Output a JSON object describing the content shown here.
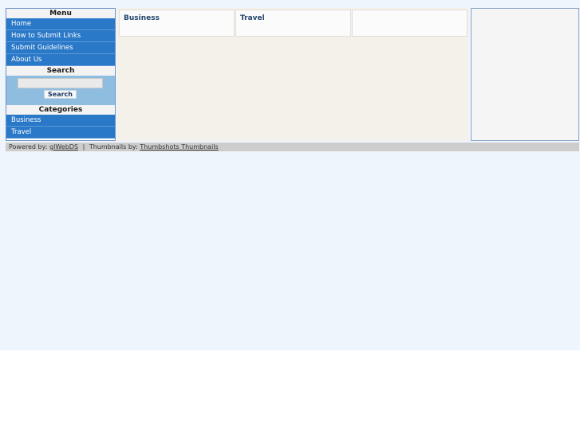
{
  "sidebar": {
    "menu_heading": "Menu",
    "menu_items": [
      {
        "label": "Home"
      },
      {
        "label": "How to Submit Links"
      },
      {
        "label": "Submit Guidelines"
      },
      {
        "label": "About Us"
      }
    ],
    "search_heading": "Search",
    "search_input_value": "",
    "search_button_label": "Search",
    "categories_heading": "Categories",
    "categories": [
      {
        "label": "Business"
      },
      {
        "label": "Travel"
      }
    ]
  },
  "content": {
    "tiles": [
      {
        "title": "Business"
      },
      {
        "title": "Travel"
      },
      {
        "title": ""
      }
    ]
  },
  "footer": {
    "powered_prefix": "Powered by:",
    "powered_link": "glWebDS",
    "separator": "|",
    "thumbs_prefix": "Thumbnails by:",
    "thumbs_link": "Thumbshots Thumbnails"
  },
  "colors": {
    "page_background": "#eef5fc",
    "sidebar_item_bg": "#2a78c8",
    "search_panel_bg": "#8fbde0",
    "content_bg": "#f4f0ea",
    "footer_bg": "#cdcdcd",
    "tile_title": "#23466b"
  }
}
